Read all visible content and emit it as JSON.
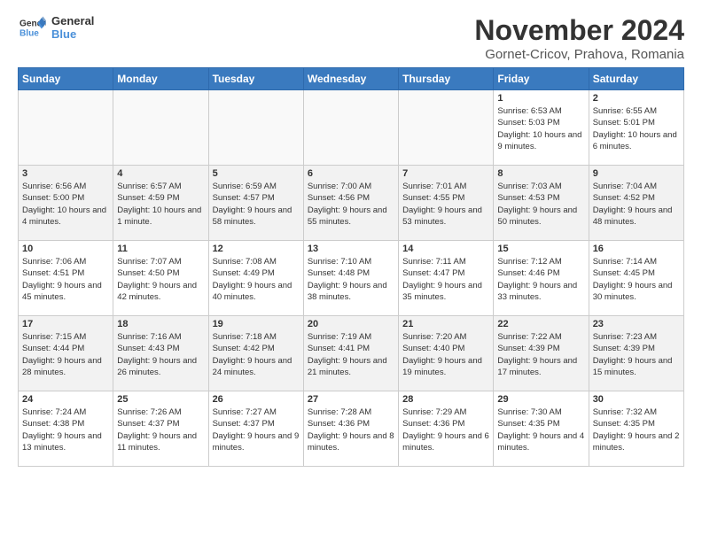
{
  "header": {
    "logo_line1": "General",
    "logo_line2": "Blue",
    "title": "November 2024",
    "location": "Gornet-Cricov, Prahova, Romania"
  },
  "weekdays": [
    "Sunday",
    "Monday",
    "Tuesday",
    "Wednesday",
    "Thursday",
    "Friday",
    "Saturday"
  ],
  "weeks": [
    [
      {
        "day": "",
        "info": ""
      },
      {
        "day": "",
        "info": ""
      },
      {
        "day": "",
        "info": ""
      },
      {
        "day": "",
        "info": ""
      },
      {
        "day": "",
        "info": ""
      },
      {
        "day": "1",
        "info": "Sunrise: 6:53 AM\nSunset: 5:03 PM\nDaylight: 10 hours and 9 minutes."
      },
      {
        "day": "2",
        "info": "Sunrise: 6:55 AM\nSunset: 5:01 PM\nDaylight: 10 hours and 6 minutes."
      }
    ],
    [
      {
        "day": "3",
        "info": "Sunrise: 6:56 AM\nSunset: 5:00 PM\nDaylight: 10 hours and 4 minutes."
      },
      {
        "day": "4",
        "info": "Sunrise: 6:57 AM\nSunset: 4:59 PM\nDaylight: 10 hours and 1 minute."
      },
      {
        "day": "5",
        "info": "Sunrise: 6:59 AM\nSunset: 4:57 PM\nDaylight: 9 hours and 58 minutes."
      },
      {
        "day": "6",
        "info": "Sunrise: 7:00 AM\nSunset: 4:56 PM\nDaylight: 9 hours and 55 minutes."
      },
      {
        "day": "7",
        "info": "Sunrise: 7:01 AM\nSunset: 4:55 PM\nDaylight: 9 hours and 53 minutes."
      },
      {
        "day": "8",
        "info": "Sunrise: 7:03 AM\nSunset: 4:53 PM\nDaylight: 9 hours and 50 minutes."
      },
      {
        "day": "9",
        "info": "Sunrise: 7:04 AM\nSunset: 4:52 PM\nDaylight: 9 hours and 48 minutes."
      }
    ],
    [
      {
        "day": "10",
        "info": "Sunrise: 7:06 AM\nSunset: 4:51 PM\nDaylight: 9 hours and 45 minutes."
      },
      {
        "day": "11",
        "info": "Sunrise: 7:07 AM\nSunset: 4:50 PM\nDaylight: 9 hours and 42 minutes."
      },
      {
        "day": "12",
        "info": "Sunrise: 7:08 AM\nSunset: 4:49 PM\nDaylight: 9 hours and 40 minutes."
      },
      {
        "day": "13",
        "info": "Sunrise: 7:10 AM\nSunset: 4:48 PM\nDaylight: 9 hours and 38 minutes."
      },
      {
        "day": "14",
        "info": "Sunrise: 7:11 AM\nSunset: 4:47 PM\nDaylight: 9 hours and 35 minutes."
      },
      {
        "day": "15",
        "info": "Sunrise: 7:12 AM\nSunset: 4:46 PM\nDaylight: 9 hours and 33 minutes."
      },
      {
        "day": "16",
        "info": "Sunrise: 7:14 AM\nSunset: 4:45 PM\nDaylight: 9 hours and 30 minutes."
      }
    ],
    [
      {
        "day": "17",
        "info": "Sunrise: 7:15 AM\nSunset: 4:44 PM\nDaylight: 9 hours and 28 minutes."
      },
      {
        "day": "18",
        "info": "Sunrise: 7:16 AM\nSunset: 4:43 PM\nDaylight: 9 hours and 26 minutes."
      },
      {
        "day": "19",
        "info": "Sunrise: 7:18 AM\nSunset: 4:42 PM\nDaylight: 9 hours and 24 minutes."
      },
      {
        "day": "20",
        "info": "Sunrise: 7:19 AM\nSunset: 4:41 PM\nDaylight: 9 hours and 21 minutes."
      },
      {
        "day": "21",
        "info": "Sunrise: 7:20 AM\nSunset: 4:40 PM\nDaylight: 9 hours and 19 minutes."
      },
      {
        "day": "22",
        "info": "Sunrise: 7:22 AM\nSunset: 4:39 PM\nDaylight: 9 hours and 17 minutes."
      },
      {
        "day": "23",
        "info": "Sunrise: 7:23 AM\nSunset: 4:39 PM\nDaylight: 9 hours and 15 minutes."
      }
    ],
    [
      {
        "day": "24",
        "info": "Sunrise: 7:24 AM\nSunset: 4:38 PM\nDaylight: 9 hours and 13 minutes."
      },
      {
        "day": "25",
        "info": "Sunrise: 7:26 AM\nSunset: 4:37 PM\nDaylight: 9 hours and 11 minutes."
      },
      {
        "day": "26",
        "info": "Sunrise: 7:27 AM\nSunset: 4:37 PM\nDaylight: 9 hours and 9 minutes."
      },
      {
        "day": "27",
        "info": "Sunrise: 7:28 AM\nSunset: 4:36 PM\nDaylight: 9 hours and 8 minutes."
      },
      {
        "day": "28",
        "info": "Sunrise: 7:29 AM\nSunset: 4:36 PM\nDaylight: 9 hours and 6 minutes."
      },
      {
        "day": "29",
        "info": "Sunrise: 7:30 AM\nSunset: 4:35 PM\nDaylight: 9 hours and 4 minutes."
      },
      {
        "day": "30",
        "info": "Sunrise: 7:32 AM\nSunset: 4:35 PM\nDaylight: 9 hours and 2 minutes."
      }
    ]
  ]
}
